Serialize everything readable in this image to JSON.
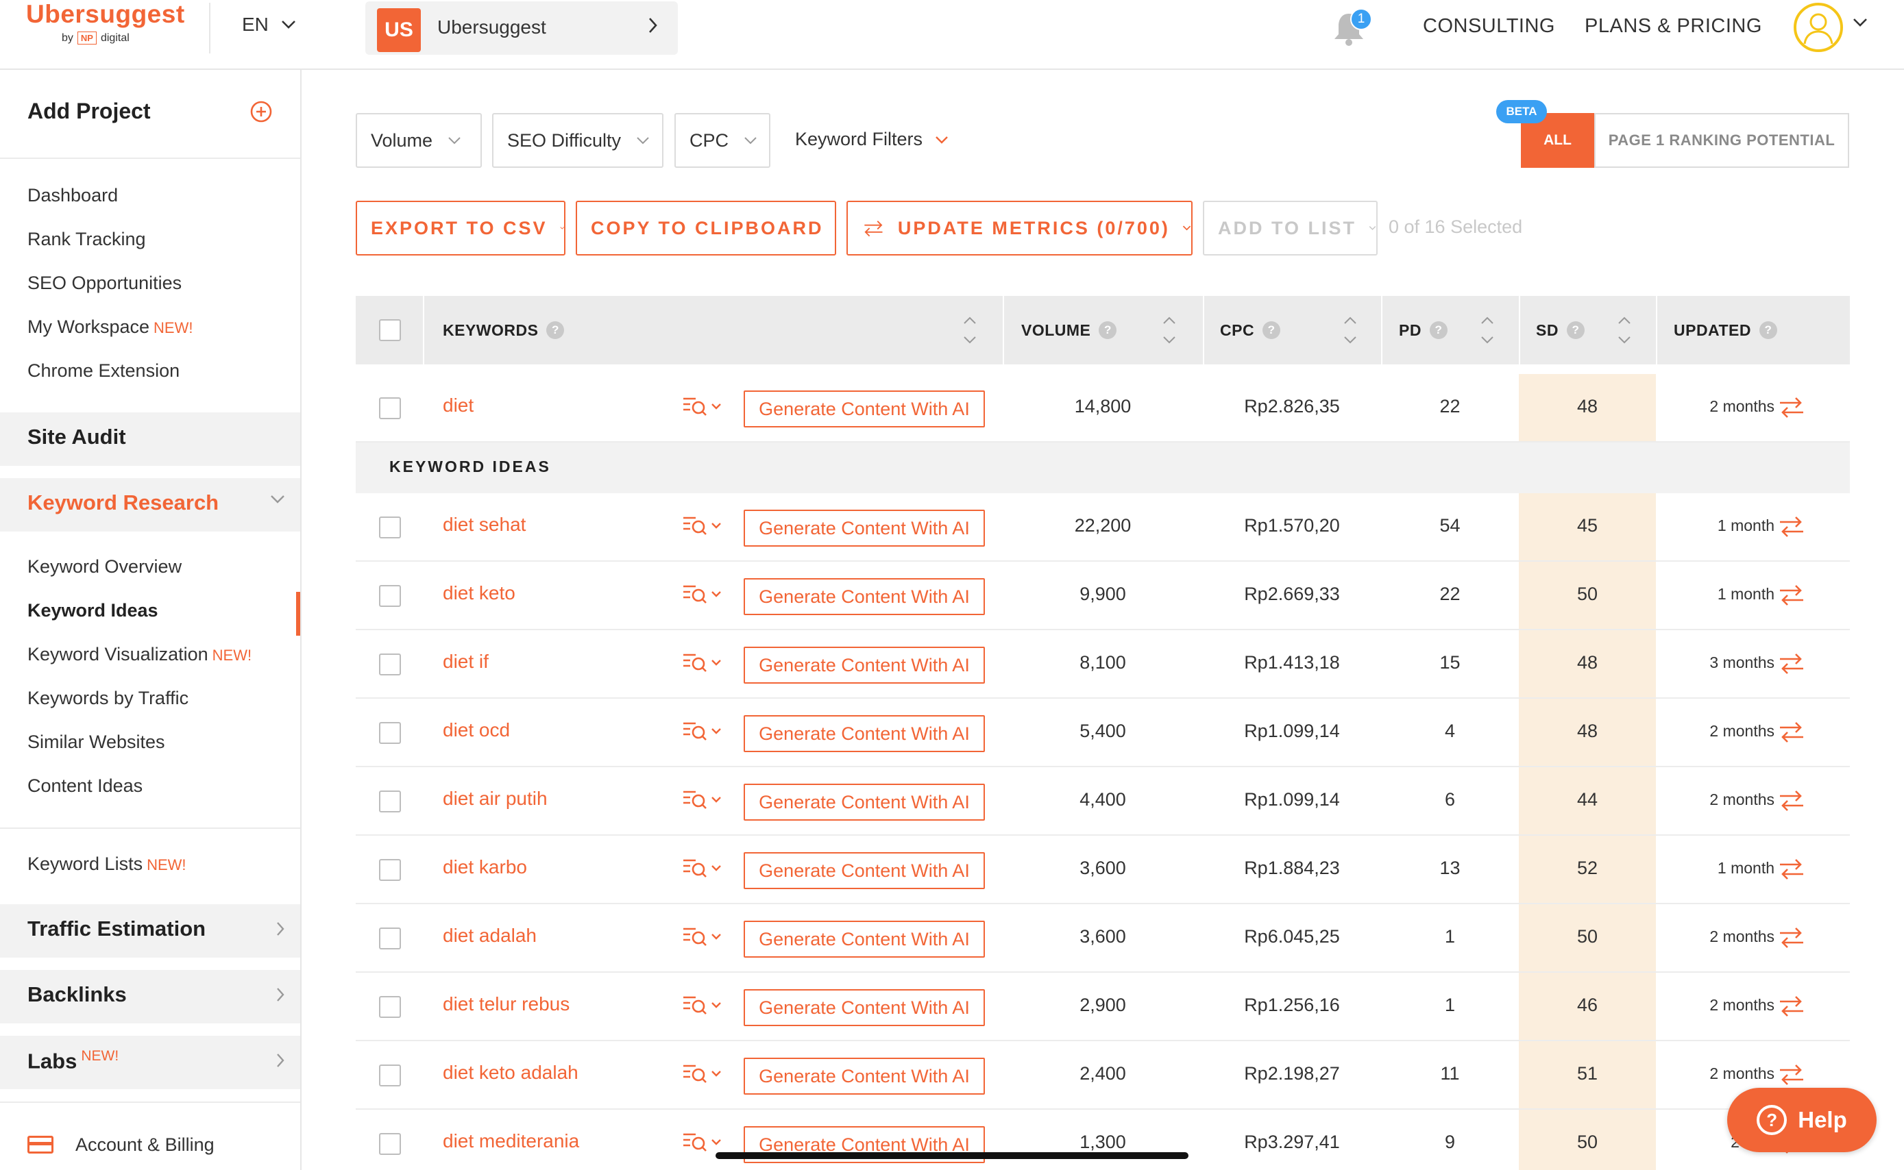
{
  "header": {
    "logo": "Ubersuggest",
    "logo_by": "by",
    "logo_np": "NP",
    "logo_digital": "digital",
    "language": "EN",
    "project_initials": "US",
    "project_name": "Ubersuggest",
    "notification_count": "1",
    "consulting": "CONSULTING",
    "plans_pricing": "PLANS & PRICING"
  },
  "sidebar": {
    "add_project": "Add Project",
    "top_items": [
      {
        "label": "Dashboard",
        "new": ""
      },
      {
        "label": "Rank Tracking",
        "new": ""
      },
      {
        "label": "SEO Opportunities",
        "new": ""
      },
      {
        "label": "My Workspace",
        "new": "NEW!"
      },
      {
        "label": "Chrome Extension",
        "new": ""
      }
    ],
    "site_audit": "Site Audit",
    "keyword_research": "Keyword Research",
    "kr_items": [
      {
        "label": "Keyword Overview",
        "new": ""
      },
      {
        "label": "Keyword Ideas",
        "new": ""
      },
      {
        "label": "Keyword Visualization",
        "new": "NEW!"
      },
      {
        "label": "Keywords by Traffic",
        "new": ""
      },
      {
        "label": "Similar Websites",
        "new": ""
      },
      {
        "label": "Content Ideas",
        "new": ""
      }
    ],
    "keyword_lists": "Keyword Lists",
    "keyword_lists_new": "NEW!",
    "traffic_estimation": "Traffic Estimation",
    "backlinks": "Backlinks",
    "labs": "Labs",
    "labs_new": "NEW!",
    "account_billing": "Account & Billing"
  },
  "filters": {
    "volume": "Volume",
    "seo_difficulty": "SEO Difficulty",
    "cpc": "CPC",
    "keyword_filters": "Keyword Filters",
    "beta": "BETA",
    "all": "ALL",
    "page1": "PAGE 1 RANKING POTENTIAL"
  },
  "actions": {
    "export_csv": "EXPORT TO CSV",
    "copy_clipboard": "COPY TO CLIPBOARD",
    "update_metrics": "UPDATE METRICS (0/700)",
    "add_to_list": "ADD TO LIST",
    "selected": "0 of 16 Selected"
  },
  "table": {
    "headers": {
      "keywords": "KEYWORDS",
      "volume": "VOLUME",
      "cpc": "CPC",
      "pd": "PD",
      "sd": "SD",
      "updated": "UPDATED"
    },
    "generate_label": "Generate Content With AI",
    "ideas_label": "KEYWORD IDEAS",
    "seed": {
      "keyword": "diet",
      "volume": "14,800",
      "cpc": "Rp2.826,35",
      "pd": "22",
      "sd": "48",
      "updated": "2 months"
    },
    "rows": [
      {
        "keyword": "diet sehat",
        "volume": "22,200",
        "cpc": "Rp1.570,20",
        "pd": "54",
        "sd": "45",
        "updated": "1 month"
      },
      {
        "keyword": "diet keto",
        "volume": "9,900",
        "cpc": "Rp2.669,33",
        "pd": "22",
        "sd": "50",
        "updated": "1 month"
      },
      {
        "keyword": "diet if",
        "volume": "8,100",
        "cpc": "Rp1.413,18",
        "pd": "15",
        "sd": "48",
        "updated": "3 months"
      },
      {
        "keyword": "diet ocd",
        "volume": "5,400",
        "cpc": "Rp1.099,14",
        "pd": "4",
        "sd": "48",
        "updated": "2 months"
      },
      {
        "keyword": "diet air putih",
        "volume": "4,400",
        "cpc": "Rp1.099,14",
        "pd": "6",
        "sd": "44",
        "updated": "2 months"
      },
      {
        "keyword": "diet karbo",
        "volume": "3,600",
        "cpc": "Rp1.884,23",
        "pd": "13",
        "sd": "52",
        "updated": "1 month"
      },
      {
        "keyword": "diet adalah",
        "volume": "3,600",
        "cpc": "Rp6.045,25",
        "pd": "1",
        "sd": "50",
        "updated": "2 months"
      },
      {
        "keyword": "diet telur rebus",
        "volume": "2,900",
        "cpc": "Rp1.256,16",
        "pd": "1",
        "sd": "46",
        "updated": "2 months"
      },
      {
        "keyword": "diet keto adalah",
        "volume": "2,400",
        "cpc": "Rp2.198,27",
        "pd": "11",
        "sd": "51",
        "updated": "2 months"
      },
      {
        "keyword": "diet mediterania",
        "volume": "1,300",
        "cpc": "Rp3.297,41",
        "pd": "9",
        "sd": "50",
        "updated": "2 mon"
      }
    ]
  },
  "help": "Help",
  "colors": {
    "accent": "#f26536",
    "sd_highlight": "#fbeedd",
    "badge_blue": "#3aa0f3"
  }
}
